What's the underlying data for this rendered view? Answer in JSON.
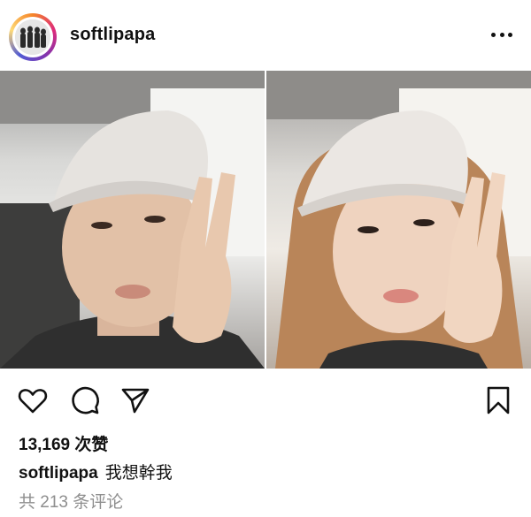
{
  "post": {
    "username": "softlipapa",
    "likes": "13,169 次赞",
    "caption": {
      "username": "softlipapa",
      "text": "我想幹我"
    },
    "view_comments": "共 213 条评论"
  },
  "icons": {
    "more": "more-options-icon",
    "like": "heart-icon",
    "comment": "comment-icon",
    "share": "share-icon",
    "save": "bookmark-icon"
  },
  "colors": {
    "text": "#111111",
    "muted": "#8e8e8e",
    "story_ring": [
      "#f58529",
      "#dd2a7b",
      "#8134af",
      "#515bd4"
    ]
  }
}
